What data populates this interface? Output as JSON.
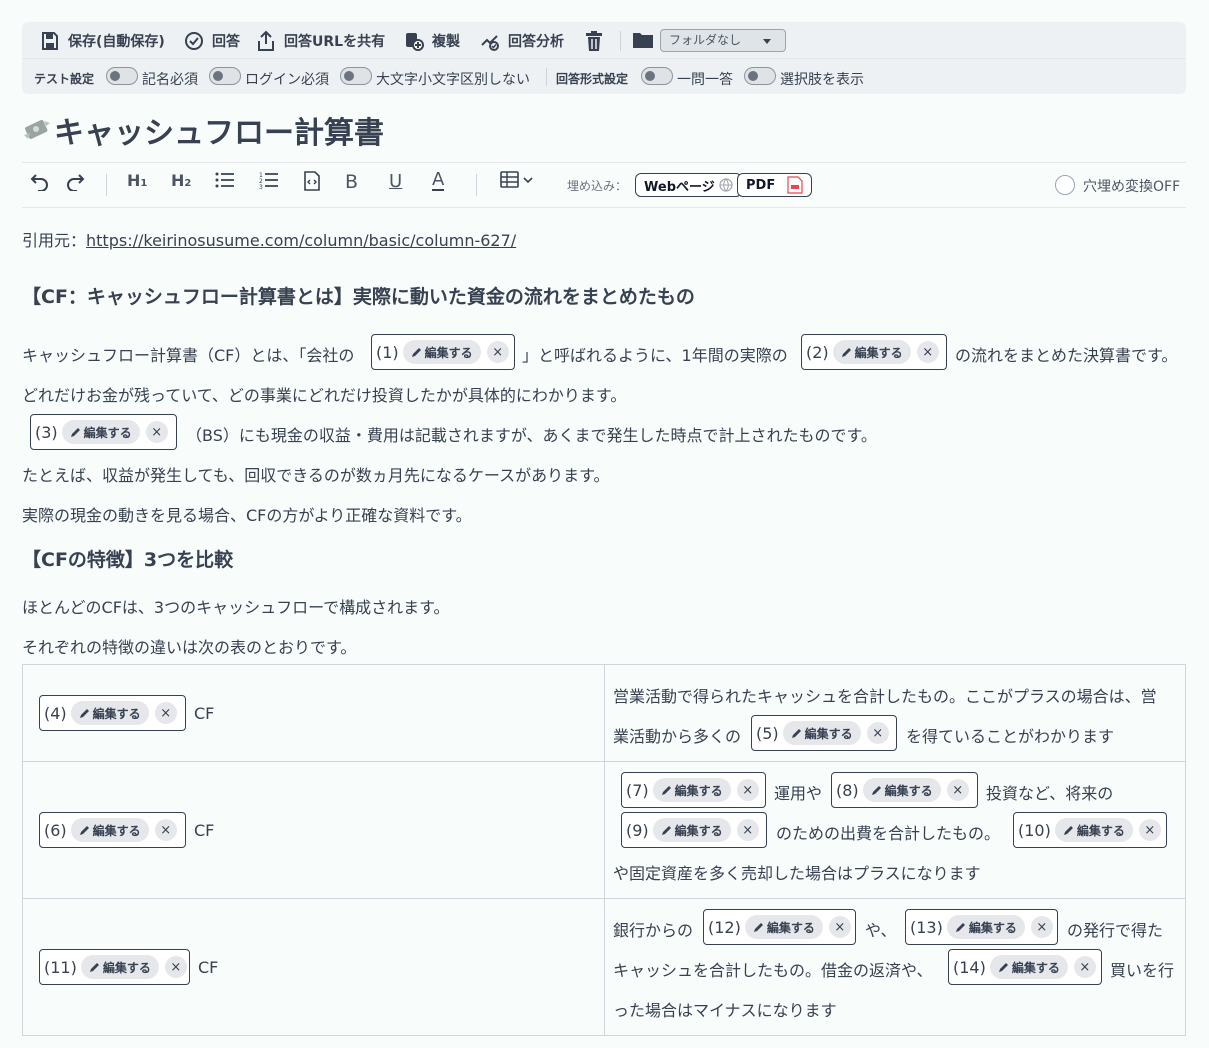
{
  "toolbar": {
    "save": "保存(自動保存)",
    "answer": "回答",
    "share": "回答URLを共有",
    "duplicate": "複製",
    "analysis": "回答分析",
    "folder": "フォルダなし"
  },
  "settings": {
    "test_label": "テスト設定",
    "named": "記名必須",
    "login": "ログイン必須",
    "case": "大文字小文字区別しない",
    "format_label": "回答形式設定",
    "one_qa": "一問一答",
    "show_choices": "選択肢を表示"
  },
  "document": {
    "title": "キャッシュフロー計算書"
  },
  "editor": {
    "embed_label": "埋め込み：",
    "web_page": "Webページ",
    "pdf": "PDF",
    "cloze_toggle": "穴埋め変換OFF"
  },
  "blank": {
    "edit": "編集する",
    "close": "×"
  },
  "content": {
    "source_prefix": "引用元：",
    "source_url": "https://keirinosusume.com/column/basic/column-627/",
    "heading1": "【CF：キャッシュフロー計算書とは】実際に動いた資金の流れをまとめたもの",
    "p1a": "キャッシュフロー計算書（CF）とは、｢会社の",
    "p1b": "」と呼ばれるように、1年間の実際の",
    "p1c": "の流れをまとめた決算書です。",
    "p2": "どれだけお金が残っていて、どの事業にどれだけ投資したかが具体的にわかります。",
    "p3": "（BS）にも現金の収益・費用は記載されますが、あくまで発生した時点で計上されたものです。",
    "p4": "たとえば、収益が発生しても、回収できるのが数ヵ月先になるケースがあります。",
    "p5": "実際の現金の動きを見る場合、CFの方がより正確な資料です。",
    "heading2": "【CFの特徴】3つを比較",
    "p6": "ほとんどのCFは、3つのキャッシュフローで構成されます。",
    "p7": "それぞれの特徴の違いは次の表のとおりです。"
  },
  "table": {
    "cf_suffix": "CF",
    "r1_text1": "営業活動で得られたキャッシュを合計したもの。ここがプラスの場合は、営",
    "r1_text2a": "業活動から多くの",
    "r1_text2b": "を得ていることがわかります",
    "r2_t1": "運用や",
    "r2_t2": "投資など、将来の",
    "r2_t3": "のための出費を合計したもの。",
    "r2_t4": "や固定資産を多く売却した場合はプラスになります",
    "r3_t1": "銀行からの",
    "r3_t2": "や、",
    "r3_t3": "の発行で得た",
    "r3_t4": "キャッシュを合計したもの。借金の返済や、",
    "r3_t5": "買いを行",
    "r3_t6": "った場合はマイナスになります"
  },
  "blanks": [
    "(1)",
    "(2)",
    "(3)",
    "(4)",
    "(5)",
    "(6)",
    "(7)",
    "(8)",
    "(9)",
    "(10)",
    "(11)",
    "(12)",
    "(13)",
    "(14)"
  ]
}
